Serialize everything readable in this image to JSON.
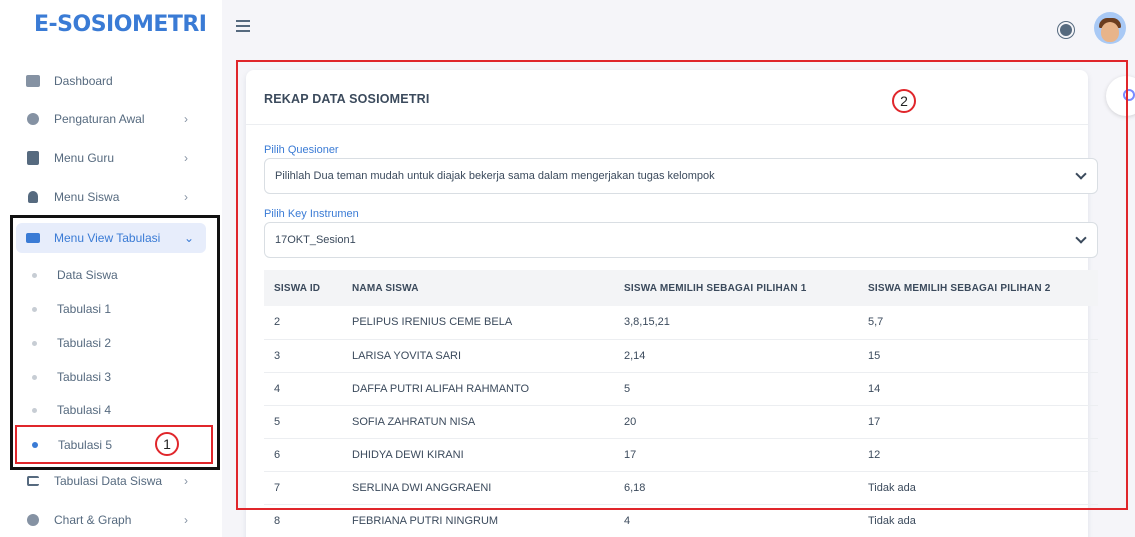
{
  "app": {
    "logo": "E-SOSIOMETRI"
  },
  "sidebar": {
    "items": [
      {
        "label": "Dashboard",
        "icon": "dashboard-icon"
      },
      {
        "label": "Pengaturan Awal",
        "icon": "settings-icon"
      },
      {
        "label": "Menu Guru",
        "icon": "document-icon"
      },
      {
        "label": "Menu Siswa",
        "icon": "user-icon"
      },
      {
        "label": "Menu View Tabulasi",
        "icon": "table-icon"
      }
    ],
    "sub_items": [
      "Data Siswa",
      "Tabulasi 1",
      "Tabulasi 2",
      "Tabulasi 3",
      "Tabulasi 4",
      "Tabulasi 5"
    ],
    "after_items": [
      {
        "label": "Tabulasi Data Siswa",
        "icon": "tree-icon"
      },
      {
        "label": "Chart & Graph",
        "icon": "pie-chart-icon"
      }
    ]
  },
  "card": {
    "title": "REKAP DATA SOSIOMETRI",
    "questioner_label": "Pilih Quesioner",
    "questioner_value": "Pilihlah Dua teman mudah untuk diajak bekerja sama dalam mengerjakan tugas kelompok",
    "key_label": "Pilih Key Instrumen",
    "key_value": "17OKT_Sesion1"
  },
  "table": {
    "headers": [
      "SISWA ID",
      "NAMA SISWA",
      "SISWA MEMILIH SEBAGAI PILIHAN 1",
      "SISWA MEMILIH SEBAGAI PILIHAN 2"
    ],
    "rows": [
      [
        "2",
        "PELIPUS IRENIUS CEME BELA",
        "3,8,15,21",
        "5,7"
      ],
      [
        "3",
        "LARISA YOVITA SARI",
        "2,14",
        "15"
      ],
      [
        "4",
        "DAFFA PUTRI ALIFAH RAHMANTO",
        "5",
        "14"
      ],
      [
        "5",
        "SOFIA ZAHRATUN NISA",
        "20",
        "17"
      ],
      [
        "6",
        "DHIDYA DEWI KIRANI",
        "17",
        "12"
      ],
      [
        "7",
        "SERLINA DWI ANGGRAENI",
        "6,18",
        "Tidak ada"
      ],
      [
        "8",
        "FEBRIANA PUTRI NINGRUM",
        "4",
        "Tidak ada"
      ]
    ]
  },
  "annotations": {
    "one": "1",
    "two": "2"
  },
  "colors": {
    "accent": "#3a7bd5",
    "annotation": "#e0262b"
  }
}
